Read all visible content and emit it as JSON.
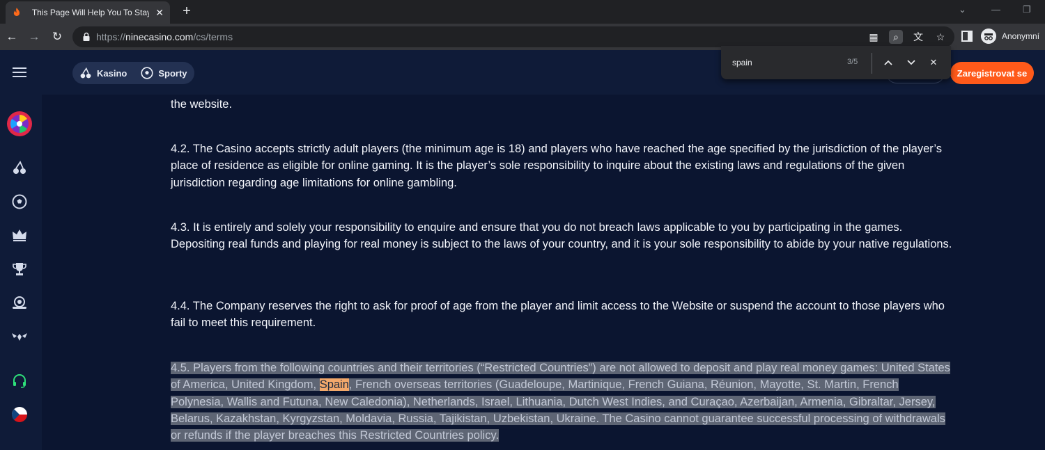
{
  "browser": {
    "tab_title": "This Page Will Help You To Stay Ir",
    "url_scheme": "https://",
    "url_host": "ninecasino.com",
    "url_path": "/cs/terms",
    "profile_label": "Anonymní"
  },
  "find": {
    "query": "spain",
    "count": "3/5"
  },
  "site": {
    "nav": [
      {
        "label": "Kasino",
        "icon": "cherries-icon"
      },
      {
        "label": "Sporty",
        "icon": "soccer-ball-icon"
      }
    ],
    "register_label": "Zaregistrovat se",
    "rail_icons": [
      "menu-icon",
      "wheel-of-fortune-icon",
      "cherries-icon",
      "soccer-ball-icon",
      "crown-icon",
      "trophy-icon",
      "live-casino-icon",
      "vip-wings-icon",
      "support-headset-icon",
      "czech-flag-icon"
    ]
  },
  "terms": {
    "prev_end": "the website.",
    "p42": "4.2.  The Casino accepts strictly adult players (the minimum age is 18) and players who have reached the age specified by the jurisdiction of the player’s place of residence as eligible for online gaming. It is the player’s sole responsibility to inquire about the existing laws and regulations of the given jurisdiction regarding age limitations for online gambling.",
    "p43": "4.3.  It is entirely and solely your responsibility to enquire and ensure that you do not breach laws applicable to you by participating in the games. Depositing real funds and playing for real money is subject to the laws of your country, and it is your sole responsibility to abide by your native regulations.",
    "p44": "4.4.  The Company reserves the right to ask for proof of age from the player and limit access to the Website or suspend the account to those players who fail to meet this requirement.",
    "p45_before": "4.5.  Players from the following countries and their territories (“Restricted Countries”) are not allowed to deposit and play real money games: United States of America, United Kingdom, ",
    "p45_match": "Spain",
    "p45_after": ", French overseas territories (Guadeloupe, Martinique, French Guiana, Réunion, Mayotte, St. Martin, French Polynesia, Wallis and Futuna, New Caledonia), Netherlands, Israel, Lithuania, Dutch West Indies, and Curaçao, Azerbaijan, Armenia, Gibraltar, Jersey, Belarus, Kazakhstan, Kyrgyzstan, Moldavia, Russia, Tajikistan, Uzbekistan, Ukraine. The Casino cannot guarantee successful processing of withdrawals or refunds if the player breaches this Restricted Countries policy."
  },
  "colors": {
    "page_bg": "#0b1530",
    "header_bg": "#0f1b38",
    "accent": "#ff5a1a",
    "find_match": "#f2a86b"
  }
}
